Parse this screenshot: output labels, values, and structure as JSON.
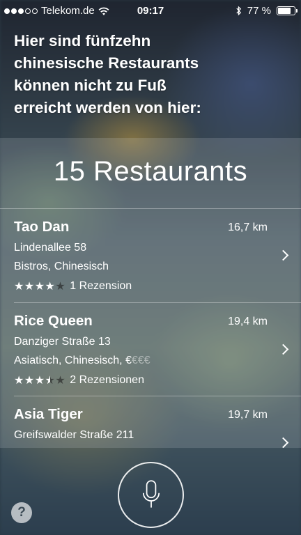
{
  "status_bar": {
    "carrier": "Telekom.de",
    "time": "09:17",
    "battery": "77 %",
    "battery_level": 0.77,
    "signal_bars_on": 3,
    "signal_bars_total": 5,
    "icons": [
      "signal-dots-icon",
      "wifi-icon",
      "bluetooth-icon",
      "battery-icon"
    ]
  },
  "siri": {
    "line1": "Hier sind fünfzehn",
    "line2": "chinesische Restaurants",
    "line3": "können nicht zu Fuß",
    "line4": "erreicht werden von hier:"
  },
  "results": {
    "title": "15 Restaurants",
    "items": [
      {
        "name": "Tao Dan",
        "distance": "16,7 km",
        "address": "Lindenallee 58",
        "category": "Bistros, Chinesisch",
        "price": "",
        "price_dim": "",
        "rating": 4,
        "reviews": "1 Rezension"
      },
      {
        "name": "Rice Queen",
        "distance": "19,4 km",
        "address": "Danziger Straße 13",
        "category": "Asiatisch, Chinesisch, ",
        "price": "€",
        "price_dim": "€€€",
        "rating": 3.5,
        "reviews": "2 Rezensionen"
      },
      {
        "name": "Asia Tiger",
        "distance": "19,7 km",
        "address": "Greifswalder Straße 211",
        "category": "",
        "price": "",
        "price_dim": "",
        "rating": null,
        "reviews": ""
      }
    ]
  },
  "controls": {
    "mic_icon": "microphone-icon",
    "help_label": "?"
  }
}
